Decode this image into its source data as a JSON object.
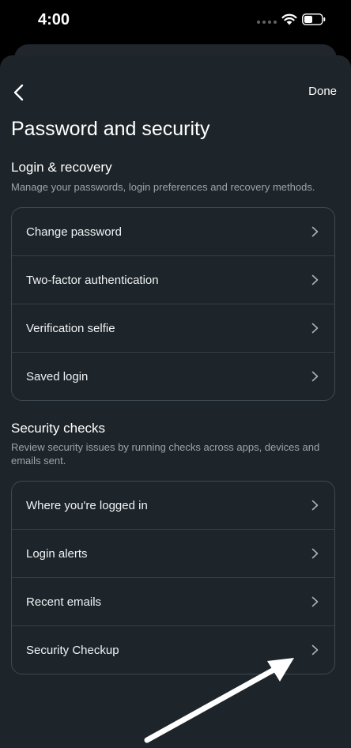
{
  "status_bar": {
    "time": "4:00"
  },
  "header": {
    "done_label": "Done",
    "title": "Password and security"
  },
  "login_recovery": {
    "title": "Login & recovery",
    "description": "Manage your passwords, login preferences and recovery methods.",
    "items": [
      {
        "label": "Change password"
      },
      {
        "label": "Two-factor authentication"
      },
      {
        "label": "Verification selfie"
      },
      {
        "label": "Saved login"
      }
    ]
  },
  "security_checks": {
    "title": "Security checks",
    "description": "Review security issues by running checks across apps, devices and emails sent.",
    "items": [
      {
        "label": "Where you're logged in"
      },
      {
        "label": "Login alerts"
      },
      {
        "label": "Recent emails"
      },
      {
        "label": "Security Checkup"
      }
    ]
  },
  "colors": {
    "sheet": "#1e252a",
    "card_border": "#3e4951",
    "secondary_text": "#9aa4ab"
  },
  "icons": [
    "back-icon",
    "chevron-right-icon",
    "wifi-icon",
    "battery-icon",
    "annotation-arrow-icon"
  ]
}
